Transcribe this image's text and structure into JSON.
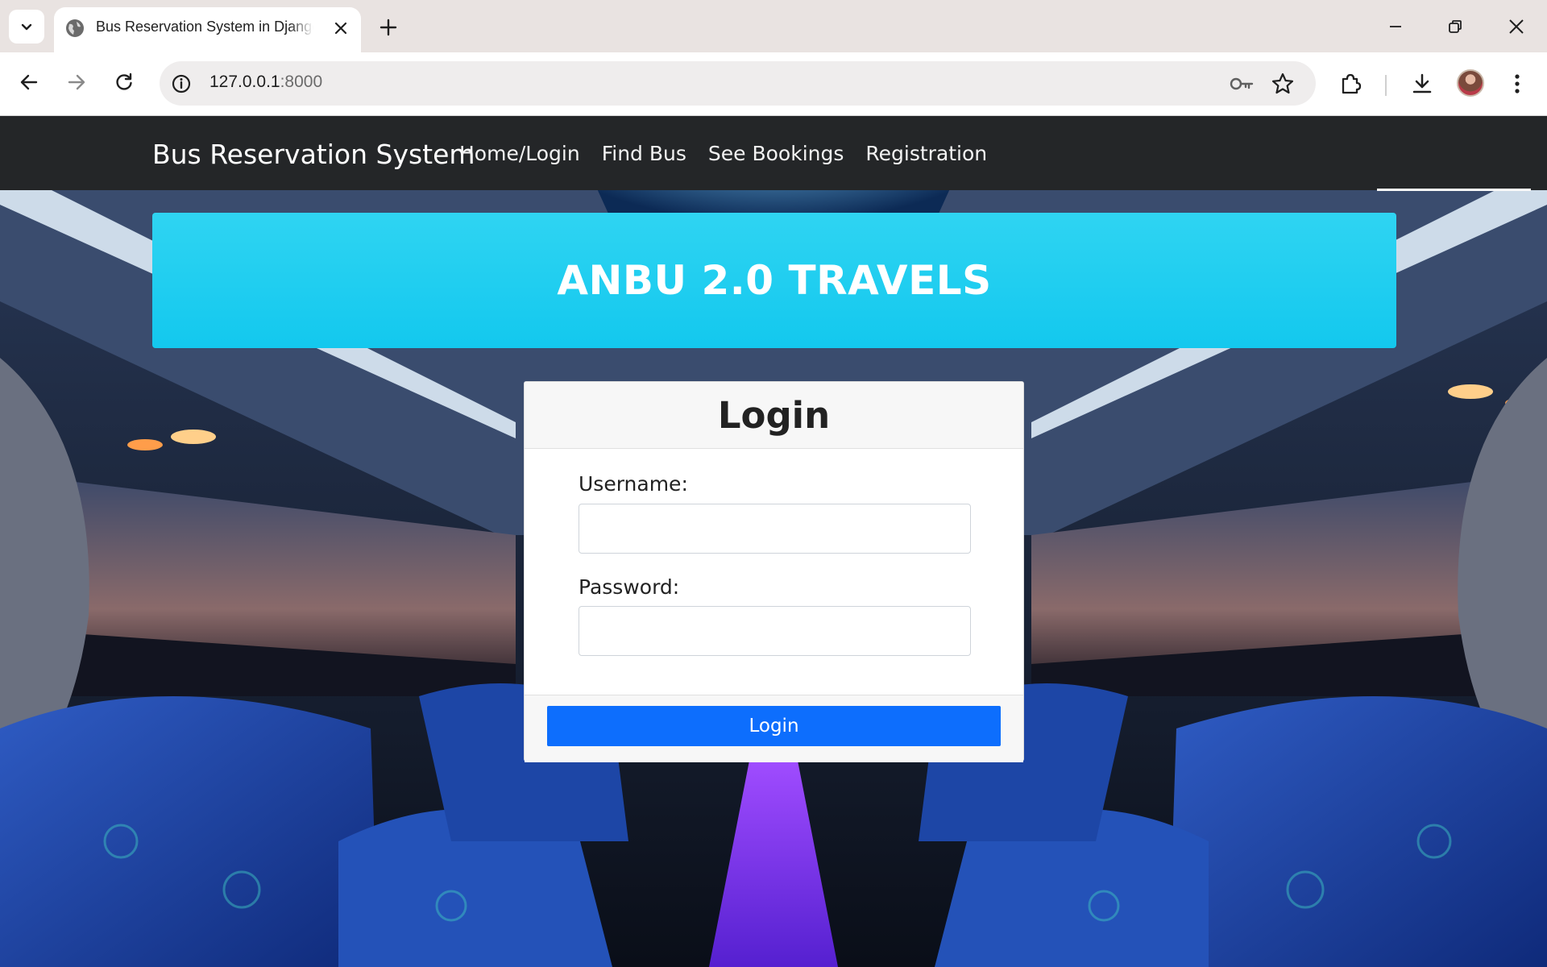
{
  "browser": {
    "tab_title": "Bus Reservation System in Django",
    "url_host": "127.0.0.1",
    "url_port": ":8000"
  },
  "site": {
    "brand": "Bus Reservation System",
    "nav": [
      "Home/Login",
      "Find Bus",
      "See Bookings",
      "Registration"
    ],
    "banner": "ANBU 2.0 TRAVELS"
  },
  "login": {
    "title": "Login",
    "username_label": "Username:",
    "password_label": "Password:",
    "username_value": "",
    "password_value": "",
    "button": "Login"
  },
  "colors": {
    "navbar": "#242628",
    "banner": "#1ccbef",
    "primary": "#0d6efd"
  }
}
